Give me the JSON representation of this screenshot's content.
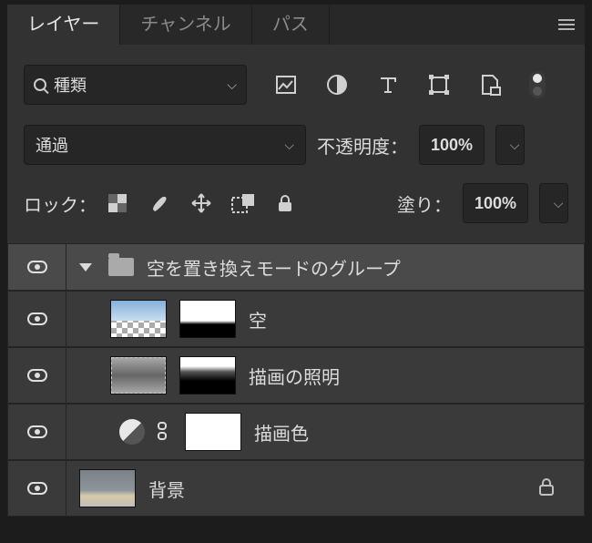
{
  "tabs": {
    "layers": "レイヤー",
    "channels": "チャンネル",
    "paths": "パス"
  },
  "filter": {
    "label": "種類"
  },
  "blend": {
    "mode": "通過",
    "opacity_label": "不透明度：",
    "opacity_value": "100%"
  },
  "lock": {
    "label": "ロック：",
    "fill_label": "塗り：",
    "fill_value": "100%"
  },
  "layers": {
    "group": "空を置き換えモードのグループ",
    "sky": "空",
    "lighting": "描画の照明",
    "fgcolor": "描画色",
    "background": "背景"
  }
}
